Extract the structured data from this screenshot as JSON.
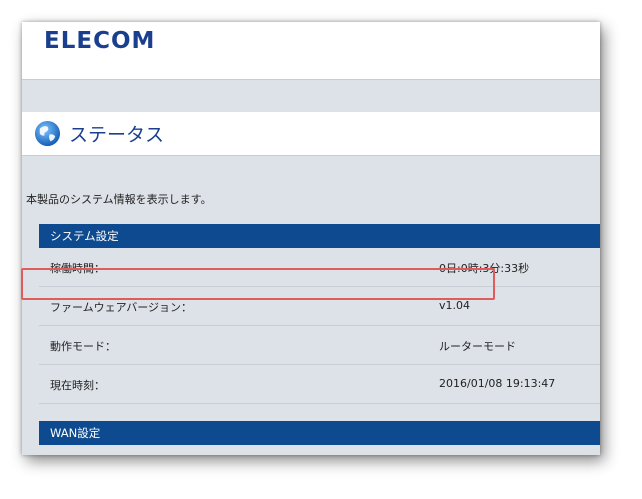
{
  "header": {
    "logo": "ELECOM"
  },
  "page": {
    "title": "ステータス",
    "description": "本製品のシステム情報を表示します。"
  },
  "system_section": {
    "title": "システム設定",
    "rows": [
      {
        "label": "稼働時間：",
        "value": "0日:0時:3分:33秒"
      },
      {
        "label": "ファームウェアバージョン：",
        "value": "v1.04"
      },
      {
        "label": "動作モード：",
        "value": "ルーターモード"
      },
      {
        "label": "現在時刻：",
        "value": "2016/01/08 19:13:47"
      }
    ]
  },
  "wan_section": {
    "title": "WAN設定"
  },
  "colors": {
    "brand": "#1b3f8f",
    "section_header": "#0e4a8f",
    "background": "#dde2e8",
    "highlight": "#e05c5c"
  }
}
